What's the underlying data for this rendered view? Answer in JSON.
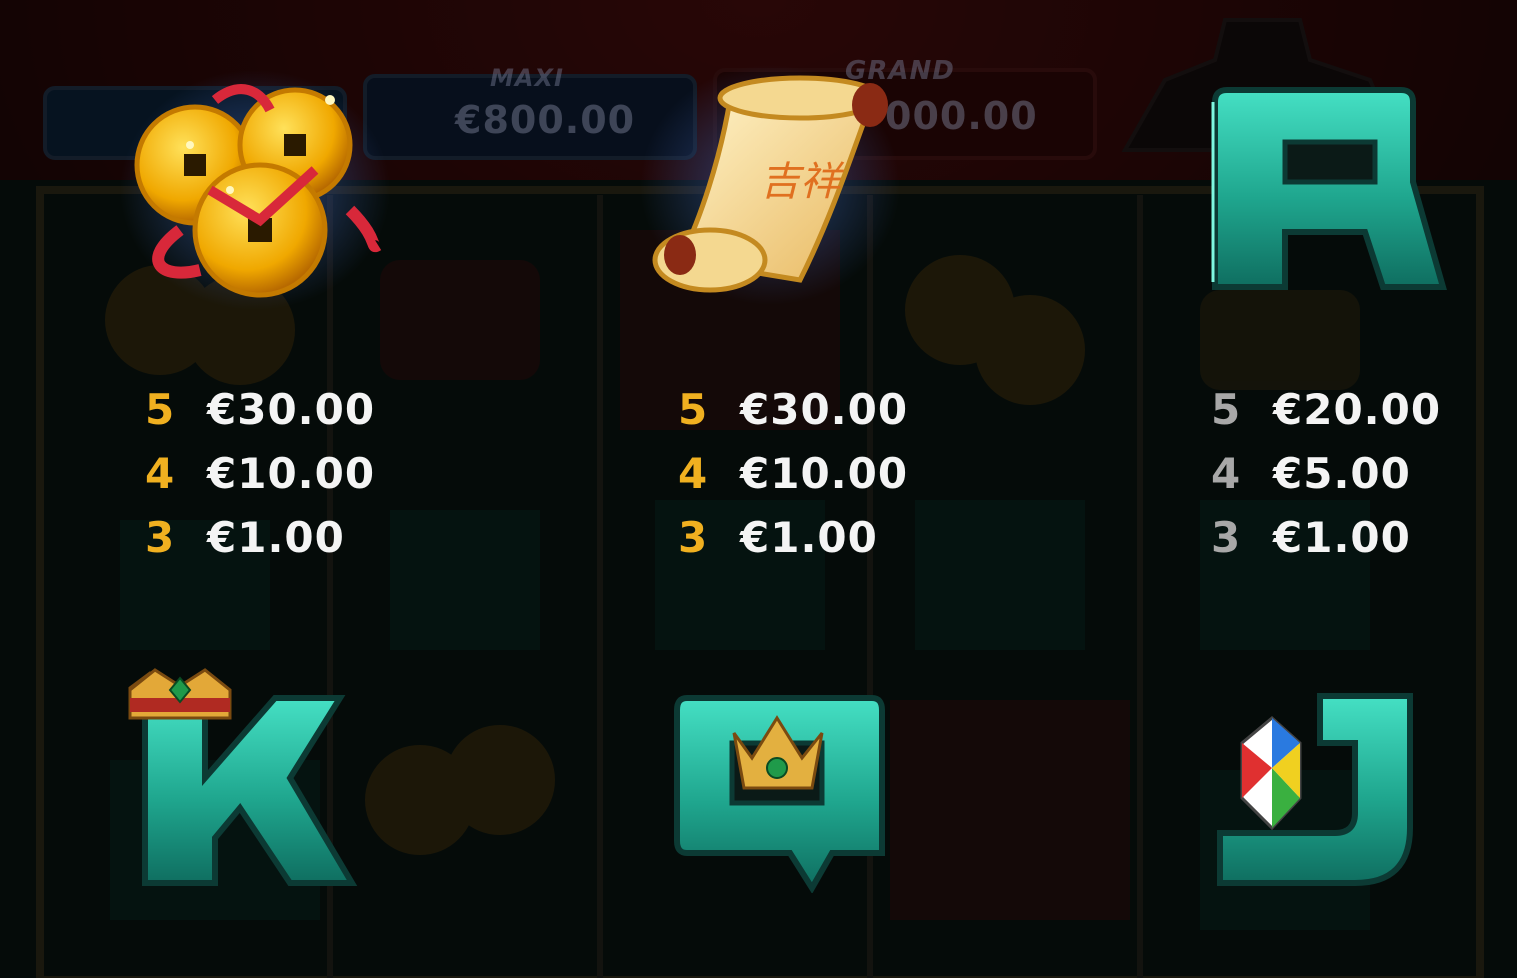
{
  "jackpots": [
    {
      "label": "MAXI",
      "value": "€800.00"
    },
    {
      "label": "GRAND",
      "value": "000.00"
    }
  ],
  "symbols": {
    "coins": {
      "icon": "gold-coins-icon"
    },
    "scroll": {
      "icon": "scroll-icon"
    },
    "a": {
      "icon": "letter-a-icon"
    },
    "k": {
      "icon": "letter-k-crown-icon"
    },
    "q": {
      "icon": "letter-q-crown-icon"
    },
    "j": {
      "icon": "letter-j-gem-icon"
    }
  },
  "paytables": {
    "coins": [
      {
        "count": "5",
        "amount": "€30.00"
      },
      {
        "count": "4",
        "amount": "€10.00"
      },
      {
        "count": "3",
        "amount": "€1.00"
      }
    ],
    "scroll": [
      {
        "count": "5",
        "amount": "€30.00"
      },
      {
        "count": "4",
        "amount": "€10.00"
      },
      {
        "count": "3",
        "amount": "€1.00"
      }
    ],
    "a": [
      {
        "count": "5",
        "amount": "€20.00"
      },
      {
        "count": "4",
        "amount": "€5.00"
      },
      {
        "count": "3",
        "amount": "€1.00"
      }
    ]
  },
  "colors": {
    "count_gold": "#f0b020",
    "count_grey": "#a8a8a8",
    "amount": "#f4f4f4",
    "letter_teal": "#1fbfa5"
  }
}
